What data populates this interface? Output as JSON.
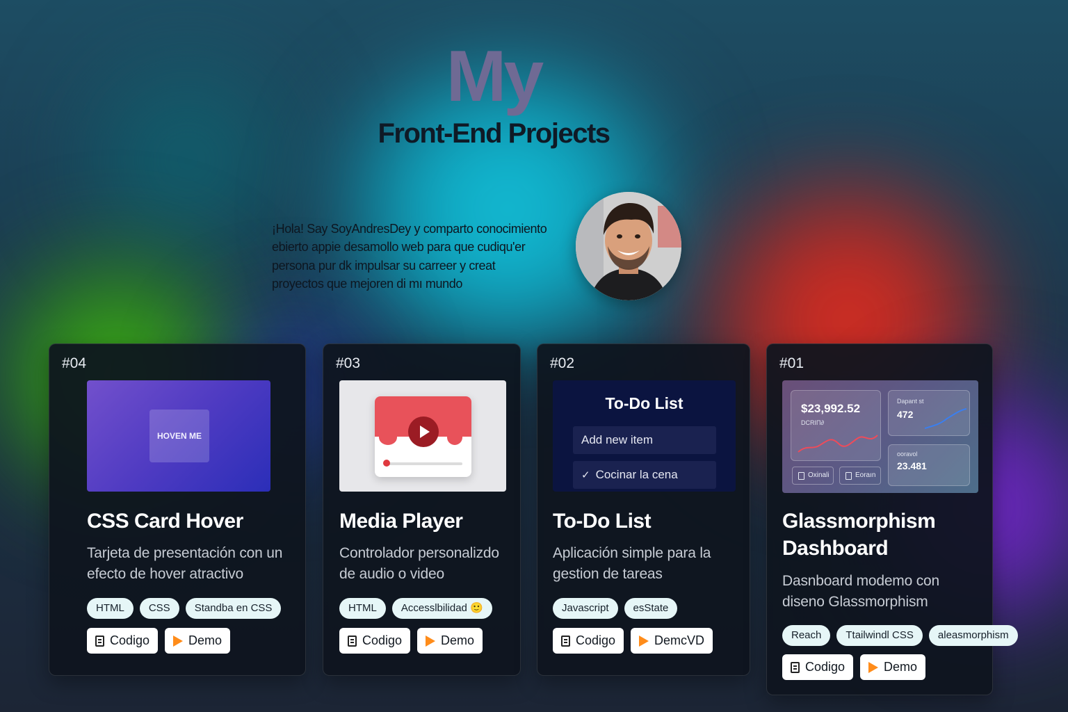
{
  "hero": {
    "my": "My",
    "title": "Front-End Projects"
  },
  "intro": {
    "text": "¡Hola! Say SoyAndresDey y comparto conocimiento ebierto appie desamollo web para que cudiqu'er persona pur dk impulsar su carreer y creat proyectos que mejoren di mı mundo"
  },
  "avatar": {
    "icon": "profile-photo"
  },
  "colors": {
    "card_bg": "#0e141e",
    "tag_bg": "#e6f6f7",
    "button_bg": "#ffffff",
    "play_icon": "#ff8c1a",
    "glow_cyan": "#16c8e0",
    "glow_green": "#46c220",
    "glow_red": "#e03022",
    "glow_purple": "#7a2cd0"
  },
  "projects": [
    {
      "number": "#04",
      "title": "CSS Card Hover",
      "description": "Tarjeta de presentación con un efecto de hover atractivo",
      "tags": [
        "HTML",
        "CSS",
        "Standba en CSS"
      ],
      "code_label": "Codigo",
      "demo_label": "Demo",
      "thumb": {
        "button_label": "HOVEN ME"
      }
    },
    {
      "number": "#03",
      "title": "Media Player",
      "description": "Controlador personalizdo de audio o video",
      "tags": [
        "HTML",
        "Accesslbilidad 🙂"
      ],
      "code_label": "Codigo",
      "demo_label": "Demo",
      "thumb": {
        "icon": "video-player-icon"
      }
    },
    {
      "number": "#02",
      "title": "To-Do List",
      "description": "Aplicación simple para la gestion de tareas",
      "tags": [
        "Javascript",
        "esState"
      ],
      "code_label": "Codigo",
      "demo_label": "DemcVD",
      "thumb": {
        "heading": "To-Do List",
        "input_placeholder": "Add new item",
        "item": "Cocinar la cena"
      }
    },
    {
      "number": "#01",
      "title": "Glassmorphism Dashboard",
      "description": "Dasnboard modemo con diseno Glassmorphism",
      "tags": [
        "Reach",
        "Ttailwindl CSS",
        "aleasmorphism"
      ],
      "code_label": "Codigo",
      "demo_label": "Demo",
      "thumb": {
        "amount": "$23,992.52",
        "amount_caption": "DCRIΠ∂",
        "stat1_caption": "Dapant st",
        "stat1_value": "472",
        "stat2_caption": "ooravol",
        "stat2_value": "23.481",
        "button1": "Oxinali",
        "button2": "Eoraın"
      }
    }
  ]
}
